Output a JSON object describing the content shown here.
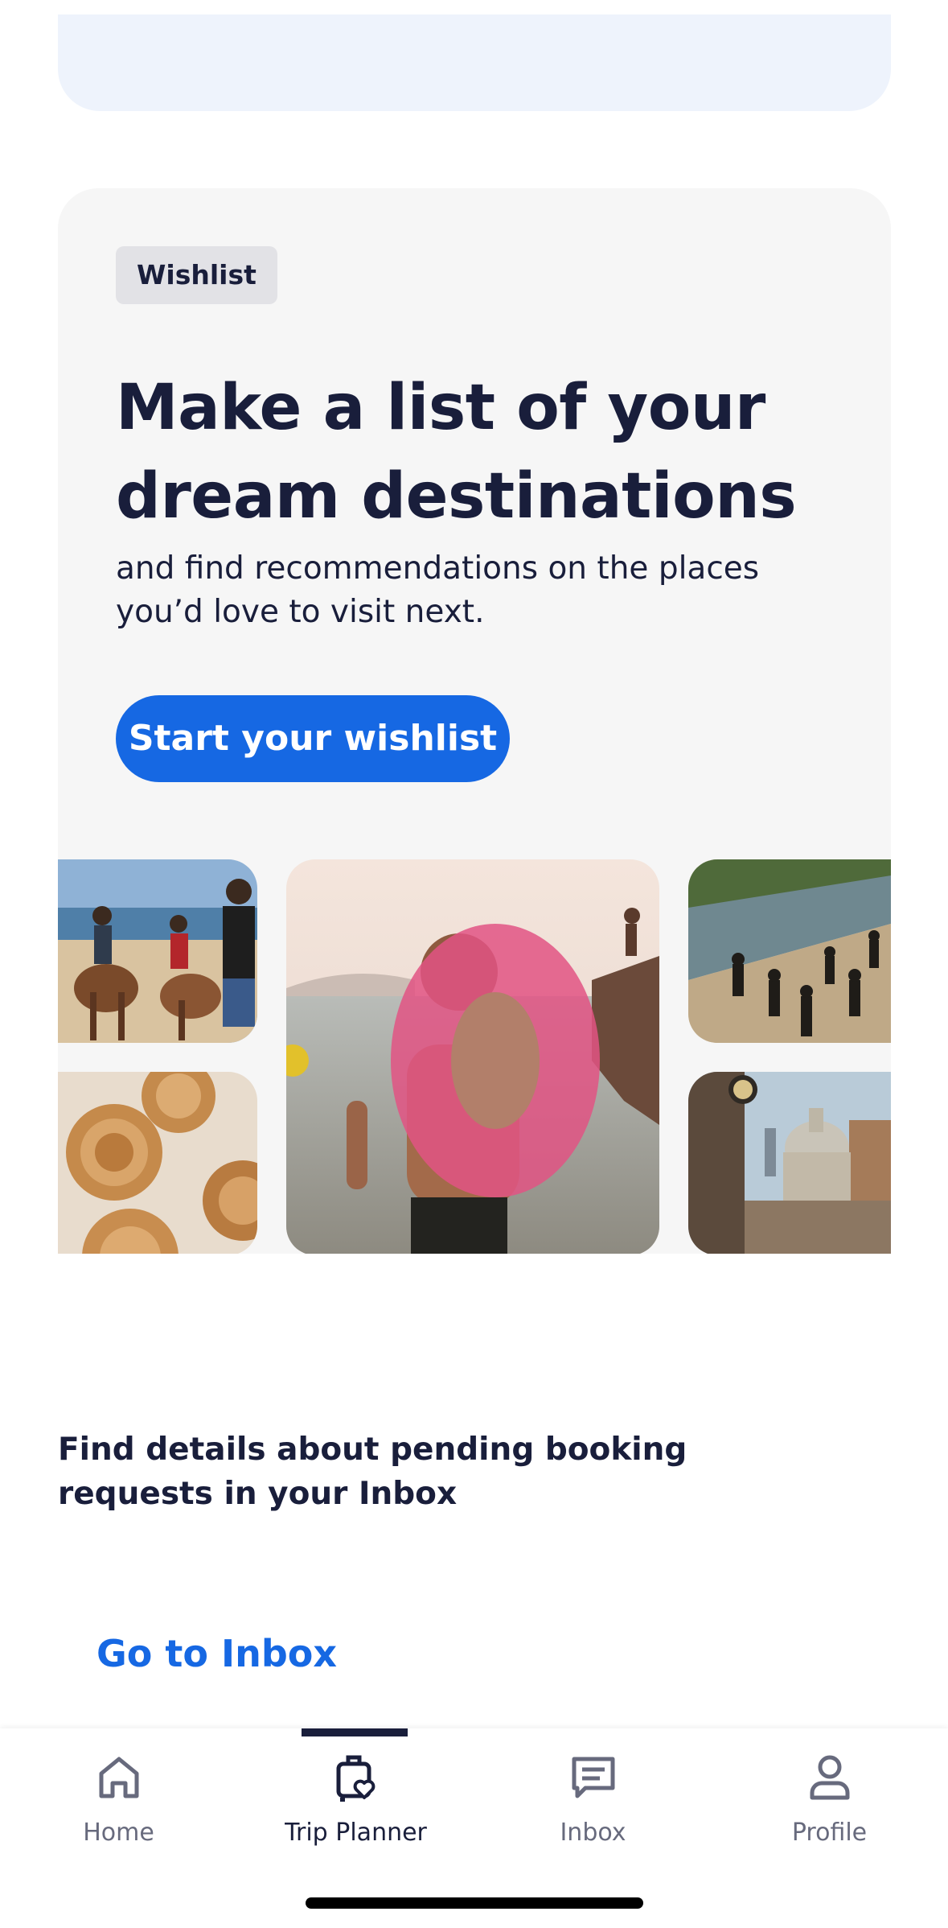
{
  "wishlist_card": {
    "badge": "Wishlist",
    "headline": "Make a list of your dream destinations",
    "subtext": "and find recommendations on the places you’d love to visit next.",
    "cta_label": "Start your wishlist"
  },
  "booking_info": {
    "message": "Find details about pending booking requests in your Inbox",
    "link_label": "Go to Inbox"
  },
  "bottom_nav": {
    "items": [
      {
        "label": "Home",
        "icon": "home-icon",
        "active": false
      },
      {
        "label": "Trip Planner",
        "icon": "trip-planner-icon",
        "active": true
      },
      {
        "label": "Inbox",
        "icon": "inbox-icon",
        "active": false
      },
      {
        "label": "Profile",
        "icon": "profile-icon",
        "active": false
      }
    ]
  },
  "colors": {
    "brand_blue": "#1668e3",
    "text_dark": "#191e3b",
    "nav_inactive": "#676a7d",
    "card_bg": "#f6f6f6",
    "top_card_bg": "#eef3fc"
  }
}
